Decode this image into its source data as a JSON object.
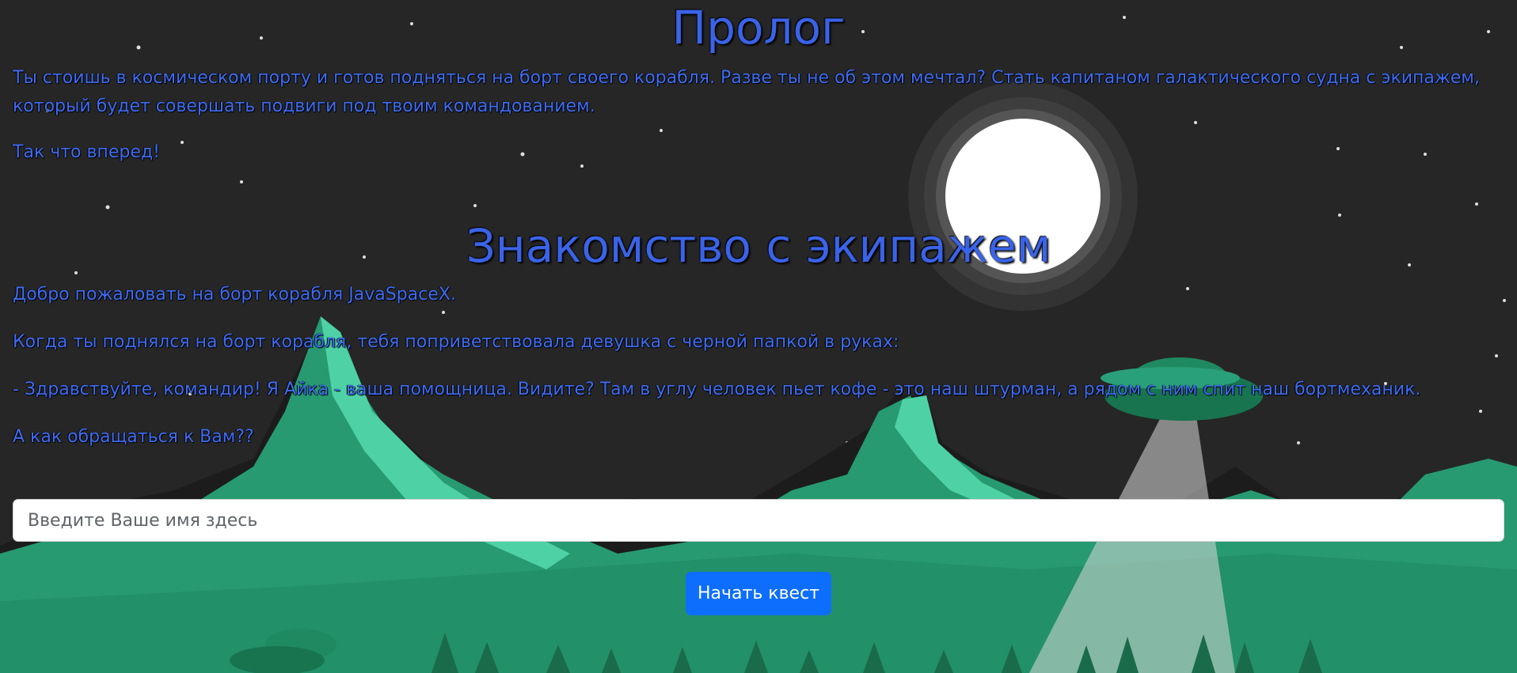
{
  "prologue": {
    "title": "Пролог",
    "paragraph1": "Ты стоишь в космическом порту и готов подняться на борт своего корабля. Разве ты не об этом мечтал? Стать капитаном галактического судна с экипажем, который будет совершать подвиги под твоим командованием.",
    "paragraph2": "Так что вперед!"
  },
  "crew": {
    "title": "Знакомство с экипажем",
    "welcome": "Добро пожаловать на борт корабля JavaSpaceX.",
    "greeting": "Когда ты поднялся на борт корабля, тебя поприветствовала девушка с черной папкой в руках:",
    "dialogue": "- Здравствуйте, командир! Я Айка - ваша помощница. Видите? Там в углу человек пьет кофе - это наш штурман, а рядом с ним спит наш бортмеханик.",
    "question": "А как обращаться к Вам??"
  },
  "form": {
    "name_placeholder": "Введите Ваше имя здесь",
    "name_value": "",
    "start_button_label": "Начать квест"
  },
  "colors": {
    "background": "#262626",
    "text": "#3f6cf4",
    "heading": "#3a63e8",
    "button": "#0d6efd",
    "mountain_light": "#4ed1a5",
    "mountain_dark": "#279a72"
  }
}
